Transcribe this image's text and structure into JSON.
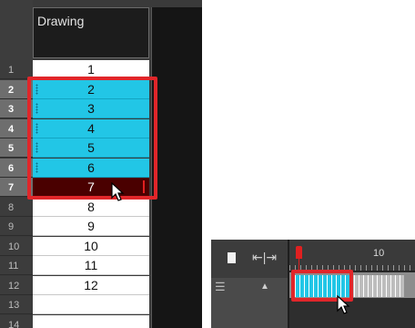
{
  "xsheet": {
    "column_header": "Drawing",
    "rows": [
      {
        "num": "1",
        "value": "1",
        "state": "normal"
      },
      {
        "num": "2",
        "value": "2",
        "state": "selected"
      },
      {
        "num": "3",
        "value": "3",
        "state": "selected"
      },
      {
        "num": "4",
        "value": "4",
        "state": "selected"
      },
      {
        "num": "5",
        "value": "5",
        "state": "selected"
      },
      {
        "num": "6",
        "value": "6",
        "state": "selected"
      },
      {
        "num": "7",
        "value": "7",
        "state": "drop-target"
      },
      {
        "num": "8",
        "value": "8",
        "state": "normal"
      },
      {
        "num": "9",
        "value": "9",
        "state": "normal"
      },
      {
        "num": "10",
        "value": "10",
        "state": "normal"
      },
      {
        "num": "11",
        "value": "11",
        "state": "normal"
      },
      {
        "num": "12",
        "value": "12",
        "state": "normal"
      },
      {
        "num": "13",
        "value": "",
        "state": "normal"
      },
      {
        "num": "14",
        "value": "",
        "state": "normal"
      }
    ],
    "highlight_color": "#e0262a",
    "selection_color": "#22c6e6"
  },
  "timeline": {
    "ruler_label": "10",
    "playhead_color": "#e02020",
    "selected_frames": 12,
    "unselected_frames": 12,
    "icons": {
      "square": "square-icon",
      "split": "split-view-icon",
      "layer": "layer-icon",
      "scroll": "scroll-up-icon"
    }
  }
}
